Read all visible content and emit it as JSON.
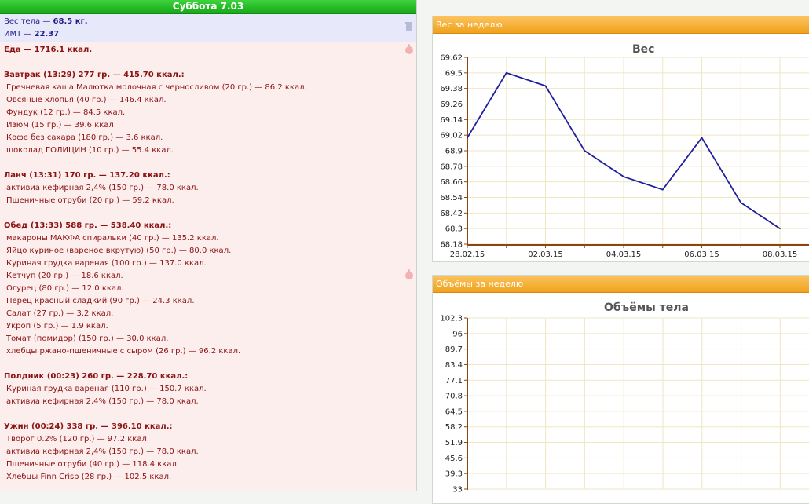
{
  "diary": {
    "day_title": "Суббота 7.03",
    "weight_label": "Вес тела — ",
    "weight_value": "68.5 кг.",
    "bmi_label": "ИМТ — ",
    "bmi_value": "22.37",
    "food_total": "Еда — 1716.1 ккал.",
    "meals": [
      {
        "header": "Завтрак (13:29) 277 гр. — 415.70 ккал.:",
        "items": [
          "Гречневая каша Малютка молочная с черносливом (20 гр.) — 86.2 ккал.",
          "Овсяные хлопья (40 гр.) — 146.4 ккал.",
          "Фундук (12 гр.) — 84.5 ккал.",
          "Изюм (15 гр.) — 39.6 ккал.",
          "Кофе без сахара (180 гр.) — 3.6 ккал.",
          "шоколад ГОЛИЦИН (10 гр.) — 55.4 ккал."
        ]
      },
      {
        "header": "Ланч (13:31) 170 гр. — 137.20 ккал.:",
        "items": [
          "активиа кефирная 2,4% (150 гр.) — 78.0 ккал.",
          "Пшеничные отруби (20 гр.) — 59.2 ккал."
        ]
      },
      {
        "header": "Обед (13:33) 588 гр. — 538.40 ккал.:",
        "items": [
          "макароны МАКФА спиральки (40 гр.) — 135.2 ккал.",
          "Яйцо куриное (вареное вкрутую) (50 гр.) — 80.0 ккал.",
          "Куриная грудка вареная (100 гр.) — 137.0 ккал.",
          "Кетчуп (20 гр.) — 18.6 ккал.",
          "Огурец (80 гр.) — 12.0 ккал.",
          "Перец красный сладкий (90 гр.) — 24.3 ккал.",
          "Салат (27 гр.) — 3.2 ккал.",
          "Укроп (5 гр.) — 1.9 ккал.",
          "Томат (помидор) (150 гр.) — 30.0 ккал.",
          "хлебцы ржано-пшеничные с сыром (26 гр.) — 96.2 ккал."
        ]
      },
      {
        "header": "Полдник (00:23) 260 гр. — 228.70 ккал.:",
        "items": [
          "Куриная грудка вареная (110 гр.) — 150.7 ккал.",
          "активиа кефирная 2,4% (150 гр.) — 78.0 ккал."
        ]
      },
      {
        "header": "Ужин (00:24) 338 гр. — 396.10 ккал.:",
        "items": [
          "Творог 0.2% (120 гр.) — 97.2 ккал.",
          "активиа кефирная 2,4% (150 гр.) — 78.0 ккал.",
          "Пшеничные отруби (40 гр.) — 118.4 ккал.",
          "Хлебцы Finn Crisp (28 гр.) — 102.5 ккал."
        ]
      }
    ]
  },
  "panels": {
    "weight_header": "Вес за неделю",
    "volumes_header": "Объёмы за неделю"
  },
  "chart_data": [
    {
      "type": "line",
      "title": "Вес",
      "y_ticks": [
        "68.18",
        "68.3",
        "68.42",
        "68.54",
        "68.66",
        "68.78",
        "68.9",
        "69.02",
        "69.14",
        "69.26",
        "69.38",
        "69.5",
        "69.62"
      ],
      "ylim": [
        68.18,
        69.62
      ],
      "x_tick_labels": [
        "28.02.15",
        "02.03.15",
        "04.03.15",
        "06.03.15",
        "08.03.15"
      ],
      "x_days": [
        0,
        2,
        4,
        6,
        8
      ],
      "points": [
        {
          "day": 0,
          "value": 69.0
        },
        {
          "day": 1,
          "value": 69.5
        },
        {
          "day": 2,
          "value": 69.4
        },
        {
          "day": 3,
          "value": 68.9
        },
        {
          "day": 4,
          "value": 68.7
        },
        {
          "day": 5,
          "value": 68.6
        },
        {
          "day": 6,
          "value": 69.0
        },
        {
          "day": 7,
          "value": 68.5
        },
        {
          "day": 8,
          "value": 68.3
        }
      ],
      "line_color": "#1f1f9e",
      "grid": true
    },
    {
      "type": "line",
      "title": "Объёмы тела",
      "y_ticks": [
        "33",
        "39.3",
        "45.6",
        "51.9",
        "58.2",
        "64.5",
        "70.8",
        "77.1",
        "83.4",
        "89.7",
        "96",
        "102.3"
      ],
      "ylim": [
        33,
        102.3
      ],
      "grid": true
    }
  ]
}
